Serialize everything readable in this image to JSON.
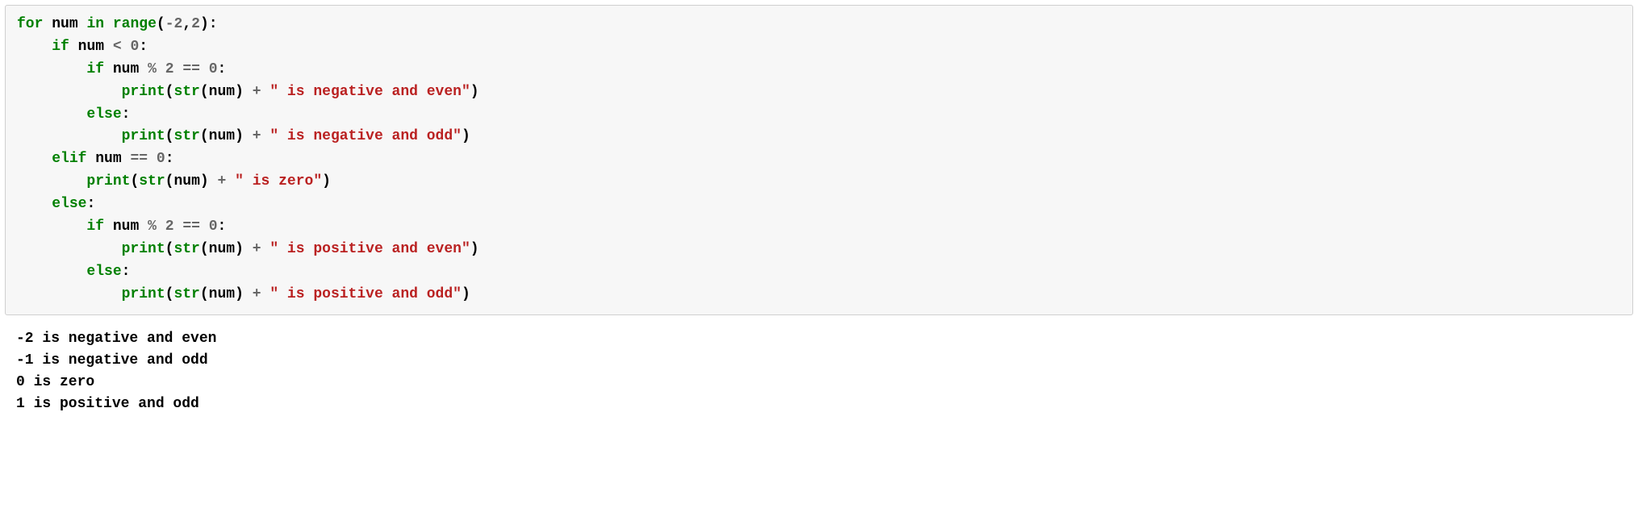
{
  "code": {
    "line1": {
      "kw_for": "for",
      "id_num": "num",
      "kw_in": "in",
      "bi_range": "range",
      "pun_open": "(",
      "op_neg": "-",
      "num_2a": "2",
      "pun_comma": ",",
      "num_2b": "2",
      "pun_close": ")",
      "pun_colon": ":"
    },
    "line2": {
      "kw_if": "if",
      "id_num": "num",
      "op_lt": "<",
      "num_0": "0",
      "pun_colon": ":"
    },
    "line3": {
      "kw_if": "if",
      "id_num": "num",
      "op_mod": "%",
      "num_2": "2",
      "op_eq": "==",
      "num_0": "0",
      "pun_colon": ":"
    },
    "line4": {
      "bi_print": "print",
      "pun_open": "(",
      "bi_str": "str",
      "pun_open2": "(",
      "id_num": "num",
      "pun_close2": ")",
      "op_plus": "+",
      "str_val": "\" is negative and even\"",
      "pun_close": ")"
    },
    "line5": {
      "kw_else": "else",
      "pun_colon": ":"
    },
    "line6": {
      "bi_print": "print",
      "pun_open": "(",
      "bi_str": "str",
      "pun_open2": "(",
      "id_num": "num",
      "pun_close2": ")",
      "op_plus": "+",
      "str_val": "\" is negative and odd\"",
      "pun_close": ")"
    },
    "line7": {
      "kw_elif": "elif",
      "id_num": "num",
      "op_eq": "==",
      "num_0": "0",
      "pun_colon": ":"
    },
    "line8": {
      "bi_print": "print",
      "pun_open": "(",
      "bi_str": "str",
      "pun_open2": "(",
      "id_num": "num",
      "pun_close2": ")",
      "op_plus": "+",
      "str_val": "\" is zero\"",
      "pun_close": ")"
    },
    "line9": {
      "kw_else": "else",
      "pun_colon": ":"
    },
    "line10": {
      "kw_if": "if",
      "id_num": "num",
      "op_mod": "%",
      "num_2": "2",
      "op_eq": "==",
      "num_0": "0",
      "pun_colon": ":"
    },
    "line11": {
      "bi_print": "print",
      "pun_open": "(",
      "bi_str": "str",
      "pun_open2": "(",
      "id_num": "num",
      "pun_close2": ")",
      "op_plus": "+",
      "str_val": "\" is positive and even\"",
      "pun_close": ")"
    },
    "line12": {
      "kw_else": "else",
      "pun_colon": ":"
    },
    "line13": {
      "bi_print": "print",
      "pun_open": "(",
      "bi_str": "str",
      "pun_open2": "(",
      "id_num": "num",
      "pun_close2": ")",
      "op_plus": "+",
      "str_val": "\" is positive and odd\"",
      "pun_close": ")"
    }
  },
  "output": {
    "line1": "-2 is negative and even",
    "line2": "-1 is negative and odd",
    "line3": "0 is zero",
    "line4": "1 is positive and odd"
  }
}
